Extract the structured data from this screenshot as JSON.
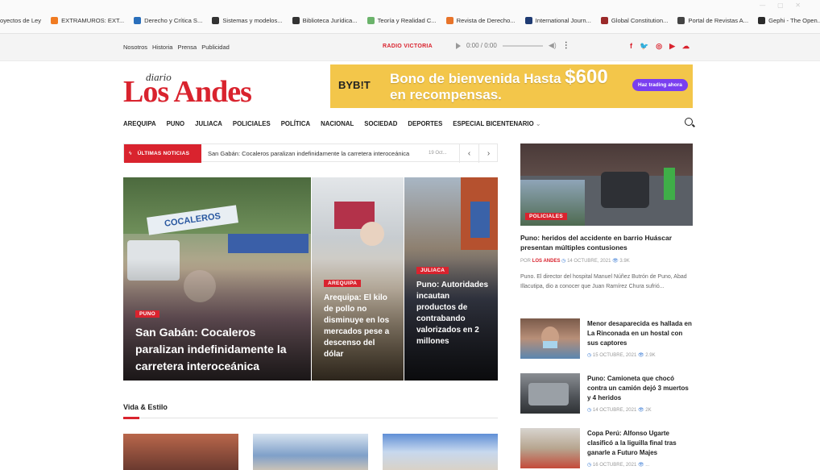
{
  "bookmarks": [
    {
      "label": "oyectos de Ley",
      "color": "#ffffff"
    },
    {
      "label": "EXTRAMUROS: EXT...",
      "color": "#f07b22"
    },
    {
      "label": "Derecho y Crítica S...",
      "color": "#2a6fbb"
    },
    {
      "label": "Sistemas y modelos...",
      "color": "#333333"
    },
    {
      "label": "Biblioteca Jurídica...",
      "color": "#333333"
    },
    {
      "label": "Teoría y Realidad C...",
      "color": "#6bb36b"
    },
    {
      "label": "Revista de Derecho...",
      "color": "#e8742a"
    },
    {
      "label": "International Journ...",
      "color": "#1f3b73"
    },
    {
      "label": "Global Constitution...",
      "color": "#9b2a2a"
    },
    {
      "label": "Portal de Revistas A...",
      "color": "#444444"
    },
    {
      "label": "Gephi - The Open...",
      "color": "#2b2b2b"
    }
  ],
  "top_links": [
    "Nosotros",
    "Historia",
    "Prensa",
    "Publicidad"
  ],
  "radio": {
    "name": "RADIO VICTORIA",
    "time": "0:00 / 0:00"
  },
  "social_icons": [
    "facebook-icon",
    "twitter-icon",
    "instagram-icon",
    "youtube-icon",
    "soundcloud-icon"
  ],
  "brand": {
    "small": "diario",
    "main": "Los Andes",
    "color": "#d9232e"
  },
  "ad": {
    "brand": "BYB!T",
    "line1": "Bono de bienvenida Hasta",
    "amount": "$600",
    "line2": "en recompensas.",
    "cta": "Haz trading ahora"
  },
  "nav": [
    "AREQUIPA",
    "PUNO",
    "JULIACA",
    "POLICIALES",
    "POLÍTICA",
    "NACIONAL",
    "SOCIEDAD",
    "DEPORTES",
    "ESPECIAL BICENTENARIO"
  ],
  "ticker": {
    "label": "ÚLTIMAS NOTICIAS",
    "text": "San Gabán: Cocaleros paralizan indefinidamente la carretera interoceánica",
    "date": "19 Oct..."
  },
  "hero": [
    {
      "badge": "PUNO",
      "title": "San Gabán: Cocaleros paralizan indefinidamente la carretera interoceánica",
      "sign": "COCALEROS"
    },
    {
      "badge": "AREQUIPA",
      "title": "Arequipa: El kilo de pollo no disminuye en los mercados pese a descenso del dólar"
    },
    {
      "badge": "JULIACA",
      "title": "Puno: Autoridades incautan productos de contrabando valorizados en 2 millones"
    }
  ],
  "section": {
    "title": "Vida & Estilo"
  },
  "featured": {
    "badge": "POLICIALES",
    "title": "Puno: heridos del accidente en barrio Huáscar presentan múltiples contusiones",
    "by": "POR",
    "author": "LOS ANDES",
    "date": "14 OCTUBRE, 2021",
    "views": "3.9K",
    "excerpt": "Puno. El director del hospital Manuel Núñez Butrón de Puno, Abad Illacutipa, dio a conocer que Juan Ramírez Chura sufrió..."
  },
  "side_list": [
    {
      "title": "Menor desaparecida es hallada en La Rinconada en un hostal con sus captores",
      "date": "15 OCTUBRE, 2021",
      "views": "2.9K"
    },
    {
      "title": "Puno: Camioneta que chocó contra un camión dejó 3 muertos y 4 heridos",
      "date": "14 OCTUBRE, 2021",
      "views": "2K"
    },
    {
      "title": "Copa Perú: Alfonso Ugarte clasificó a la liguilla final tras ganarle a Futuro Majes",
      "date": "16 OCTUBRE, 2021",
      "views": "..."
    }
  ]
}
